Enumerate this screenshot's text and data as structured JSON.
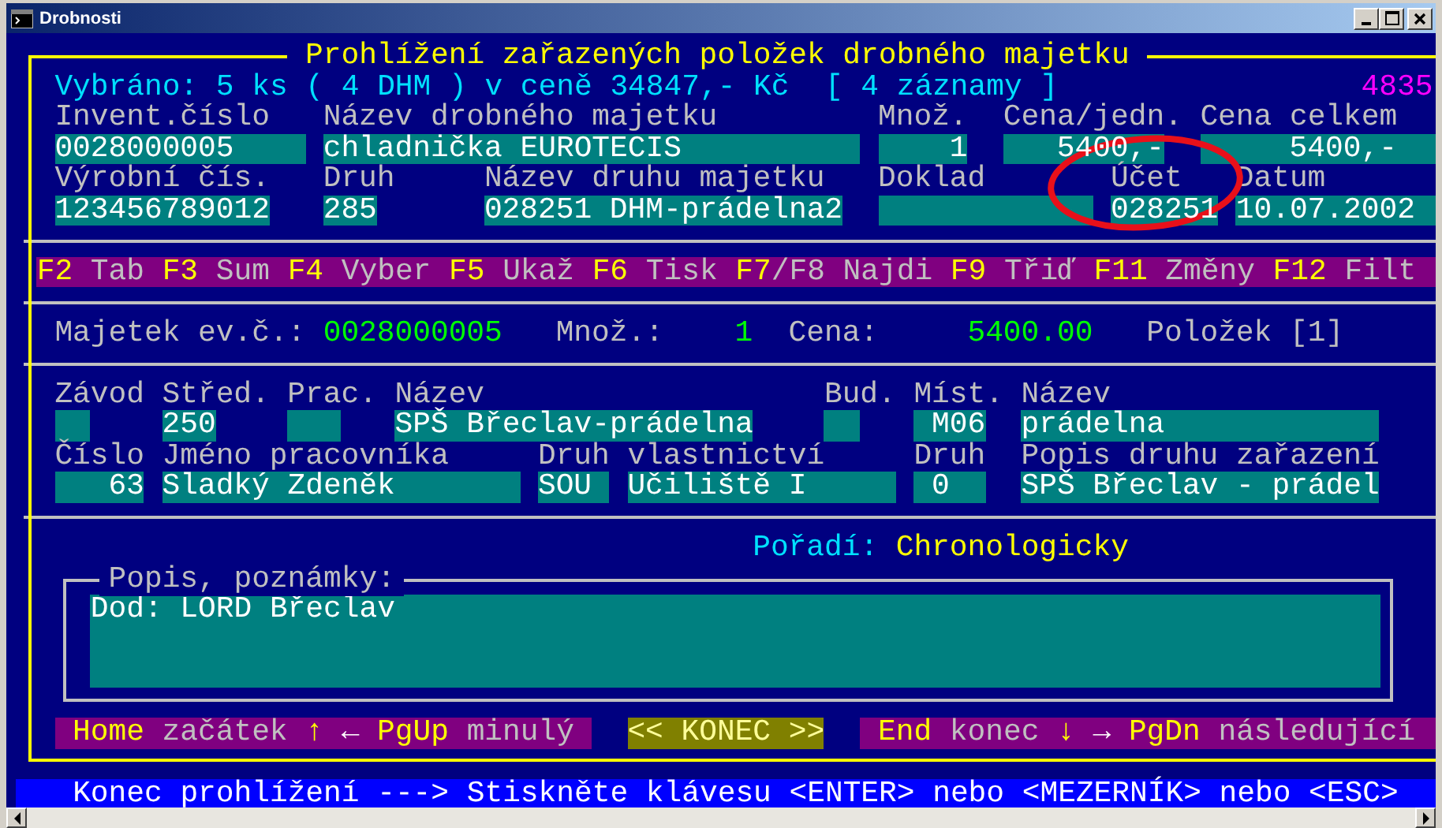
{
  "window": {
    "title": "Drobnosti"
  },
  "heading": "Prohlížení zařazených položek drobného majetku",
  "summary": "Vybráno: 5 ks ( 4 DHM ) v ceně 34847,- Kč  [ 4 záznamy ]",
  "counter": "4835",
  "item_rows": [
    [
      {
        "label": "Invent.číslo",
        "value": "0028000005"
      },
      {
        "label": "Název drobného majetku",
        "value": "chladnička EUROTECIS"
      },
      {
        "label": "Množ.",
        "value": "1"
      },
      {
        "label": "Cena/jedn.",
        "value": "5400,-"
      },
      {
        "label": "Cena celkem",
        "value": "5400,-"
      }
    ],
    [
      {
        "label": "Výrobní čís.",
        "value": "123456789012"
      },
      {
        "label": "Druh",
        "value": "285"
      },
      {
        "label": "Název druhu majetku",
        "value": "028251 DHM-prádelna2"
      },
      {
        "label": "Doklad"
      },
      {
        "label": "Účet",
        "value": "028251"
      },
      {
        "label": "Datum",
        "value": "10.07.2002"
      }
    ]
  ],
  "function_keys": [
    {
      "key": "F2",
      "label": "Tab"
    },
    {
      "key": "F3",
      "label": "Sum"
    },
    {
      "key": "F4",
      "label": "Vyber"
    },
    {
      "key": "F5",
      "label": "Ukaž"
    },
    {
      "key": "F6",
      "label": "Tisk"
    },
    {
      "key": "F7",
      "label": "/F8 Najdi",
      "attached": true
    },
    {
      "key": "F9",
      "label": "Třiď"
    },
    {
      "key": "F11",
      "label": "Změny"
    },
    {
      "key": "F12",
      "label": "Filt"
    }
  ],
  "totals": [
    {
      "label": "Majetek ev.č.:",
      "value": "0028000005"
    },
    {
      "label": "Množ.:",
      "value": "1"
    },
    {
      "label": "Cena:",
      "value": "5400.00"
    },
    {
      "label": "Položek [1]"
    }
  ],
  "detail_rows": [
    [
      {
        "label": "Závod"
      },
      {
        "label": "Střed.",
        "value": "250"
      },
      {
        "label": "Prac."
      },
      {
        "label": "Název",
        "value": "SPŠ Břeclav-prádelna"
      },
      {
        "label": "Bud."
      },
      {
        "label": "Míst.",
        "value": "M06"
      },
      {
        "label": "Název",
        "value": "prádelna"
      }
    ],
    [
      {
        "label": "Číslo",
        "value": "63"
      },
      {
        "label": "Jméno pracovníka",
        "value": "Sladký Zdeněk"
      },
      {
        "label": "Druh",
        "value": "SOU"
      },
      {
        "label": "vlastnictví",
        "value": "Učiliště I"
      },
      {
        "label": "Druh",
        "value": "0"
      },
      {
        "label": "Popis druhu zařazení",
        "value": "SPŠ Břeclav - prádel"
      }
    ]
  ],
  "order": {
    "label": "Pořadí:",
    "value": "Chronologicky"
  },
  "notes": {
    "title": "Popis, poznámky:",
    "value": "Dod: LORD Břeclav"
  },
  "nav": [
    {
      "kind": "shortcut",
      "segments": [
        {
          "kind": "key",
          "text": "Home"
        },
        {
          "kind": "label",
          "text": "začátek"
        },
        {
          "kind": "key",
          "text": "↑"
        },
        {
          "kind": "arrow",
          "text": "←"
        },
        {
          "kind": "key",
          "text": "PgUp"
        },
        {
          "kind": "label",
          "text": "minulý"
        }
      ]
    },
    {
      "kind": "button",
      "text": "<< KONEC >>"
    },
    {
      "kind": "shortcut",
      "segments": [
        {
          "kind": "key",
          "text": "End"
        },
        {
          "kind": "label",
          "text": "konec"
        },
        {
          "kind": "key",
          "text": "↓"
        },
        {
          "kind": "arrow",
          "text": "→"
        },
        {
          "kind": "key",
          "text": "PgDn"
        },
        {
          "kind": "label",
          "text": "následující"
        }
      ]
    }
  ],
  "status_bar": "Konec prohlížení ---> Stiskněte klávesu <ENTER> nebo <MEZERNÍK> nebo <ESC>"
}
